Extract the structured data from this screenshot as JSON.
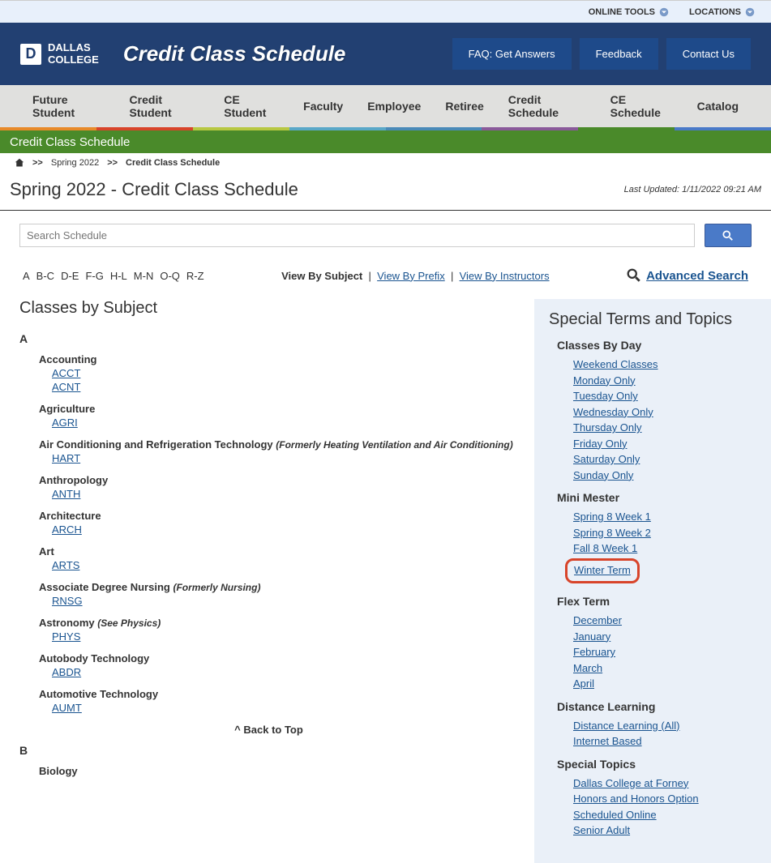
{
  "topbar": {
    "online_tools": "ONLINE TOOLS",
    "locations": "LOCATIONS"
  },
  "header": {
    "logo_text1": "DALLAS",
    "logo_text2": "COLLEGE",
    "title": "Credit Class Schedule",
    "faq": "FAQ: Get Answers",
    "feedback": "Feedback",
    "contact": "Contact Us"
  },
  "nav": {
    "future": "Future Student",
    "credit_student": "Credit Student",
    "ce_student": "CE Student",
    "faculty": "Faculty",
    "employee": "Employee",
    "retiree": "Retiree",
    "credit_schedule": "Credit Schedule",
    "ce_schedule": "CE Schedule",
    "catalog": "Catalog"
  },
  "greenbar": "Credit Class Schedule",
  "breadcrumb": {
    "spring": "Spring 2022",
    "current": "Credit Class Schedule"
  },
  "page": {
    "title": "Spring 2022 - Credit Class Schedule",
    "updated": "Last Updated: 1/11/2022 09:21 AM"
  },
  "search": {
    "placeholder": "Search Schedule"
  },
  "alpha": {
    "a": "A",
    "bc": "B-C",
    "de": "D-E",
    "fg": "F-G",
    "hl": "H-L",
    "mn": "M-N",
    "oq": "O-Q",
    "rz": "R-Z"
  },
  "viewby": {
    "label": "View By Subject",
    "prefix": "View By Prefix",
    "instructors": "View By Instructors",
    "sep": "|"
  },
  "advsearch": "Advanced Search",
  "classes_title": "Classes by Subject",
  "letterA": "A",
  "letterB": "B",
  "subjects": {
    "accounting": {
      "name": "Accounting",
      "c1": "ACCT",
      "c2": "ACNT"
    },
    "agriculture": {
      "name": "Agriculture",
      "c1": "AGRI"
    },
    "aircond": {
      "name": "Air Conditioning and Refrigeration Technology ",
      "note": "(Formerly Heating Ventilation and Air Conditioning)",
      "c1": "HART"
    },
    "anthro": {
      "name": "Anthropology",
      "c1": "ANTH"
    },
    "arch": {
      "name": "Architecture",
      "c1": "ARCH"
    },
    "art": {
      "name": "Art",
      "c1": "ARTS"
    },
    "nursing": {
      "name": "Associate Degree Nursing ",
      "note": "(Formerly Nursing)",
      "c1": "RNSG"
    },
    "astro": {
      "name": "Astronomy ",
      "note": "(See Physics)",
      "c1": "PHYS"
    },
    "autobody": {
      "name": "Autobody Technology",
      "c1": "ABDR"
    },
    "automotive": {
      "name": "Automotive Technology",
      "c1": "AUMT"
    },
    "biology": {
      "name": "Biology"
    }
  },
  "backtop": "^ Back to Top",
  "sidebar": {
    "title": "Special Terms and Topics",
    "byday": {
      "h": "Classes By Day",
      "weekend": "Weekend Classes",
      "mon": "Monday Only",
      "tue": "Tuesday Only",
      "wed": "Wednesday Only",
      "thu": "Thursday Only",
      "fri": "Friday Only",
      "sat": "Saturday Only",
      "sun": "Sunday Only"
    },
    "mini": {
      "h": "Mini Mester",
      "s1": "Spring 8 Week 1",
      "s2": "Spring 8 Week 2",
      "f1": "Fall 8 Week 1",
      "winter": "Winter Term"
    },
    "flex": {
      "h": "Flex Term",
      "dec": "December",
      "jan": "January",
      "feb": "February",
      "mar": "March",
      "apr": "April"
    },
    "dist": {
      "h": "Distance Learning",
      "all": "Distance Learning (All)",
      "net": "Internet Based"
    },
    "special": {
      "h": "Special Topics",
      "forney": "Dallas College at Forney",
      "honors": "Honors and Honors Option",
      "sched": "Scheduled Online",
      "senior": "Senior Adult"
    }
  }
}
